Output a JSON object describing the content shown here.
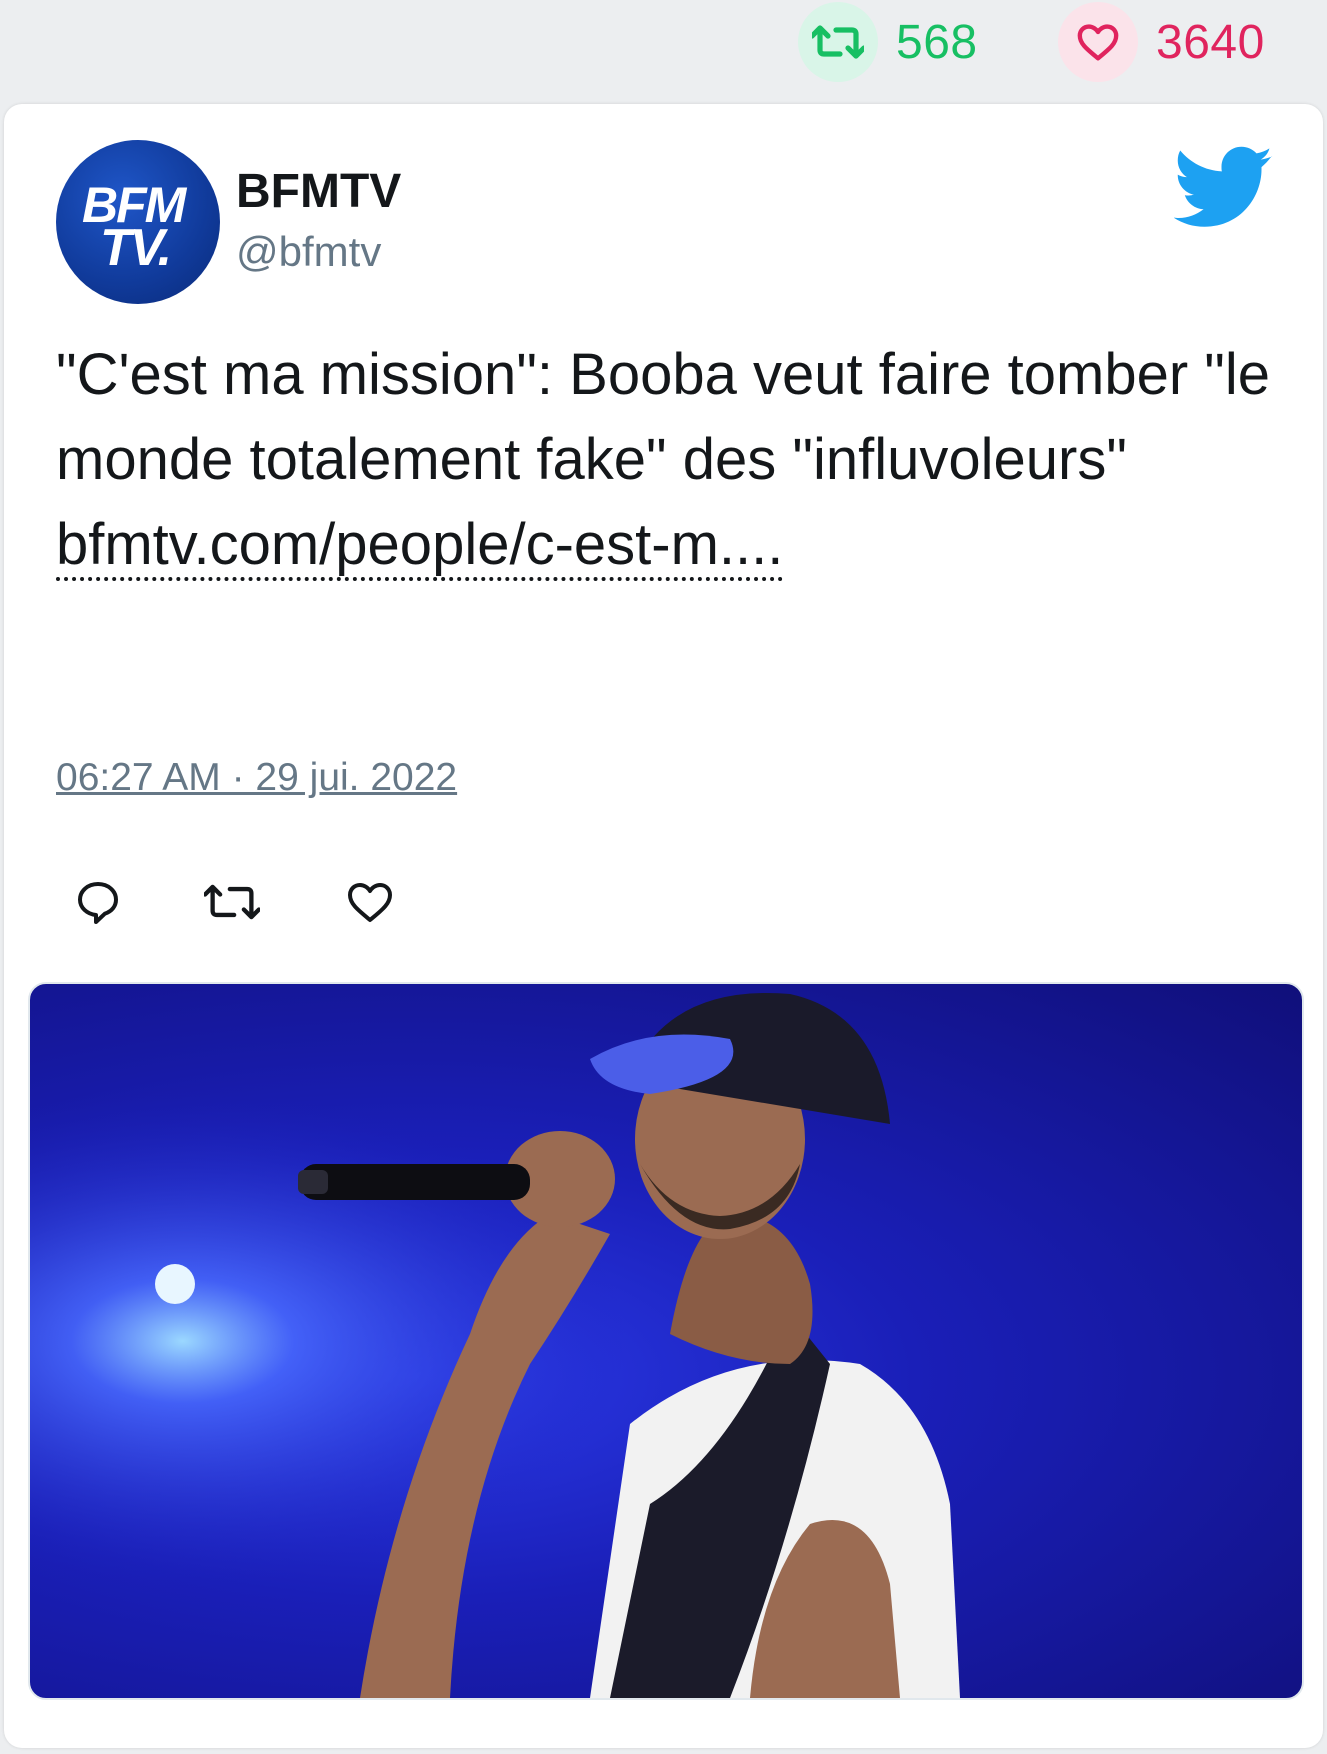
{
  "stats": {
    "retweets": "568",
    "likes": "3640",
    "retweet_icon": "retweet-icon",
    "like_icon": "heart-icon",
    "retweet_color": "#17bf63",
    "like_color": "#e0245e"
  },
  "tweet": {
    "author_name": "BFMTV",
    "author_handle": "@bfmtv",
    "avatar_text_line1": "BFM",
    "avatar_text_line2": "TV.",
    "text": "\"C'est ma mission\": Booba veut faire tomber \"le monde totalement fake\" des \"influvoleurs\" ",
    "link_text": "bfmtv.com/people/c-est-m....",
    "timestamp": "06:27 AM · 29 jui. 2022",
    "brand_color": "#1da1f2",
    "media_icon": "concert-photo"
  },
  "actions": {
    "reply_icon": "reply-icon",
    "retweet_icon": "retweet-icon",
    "like_icon": "heart-icon"
  }
}
